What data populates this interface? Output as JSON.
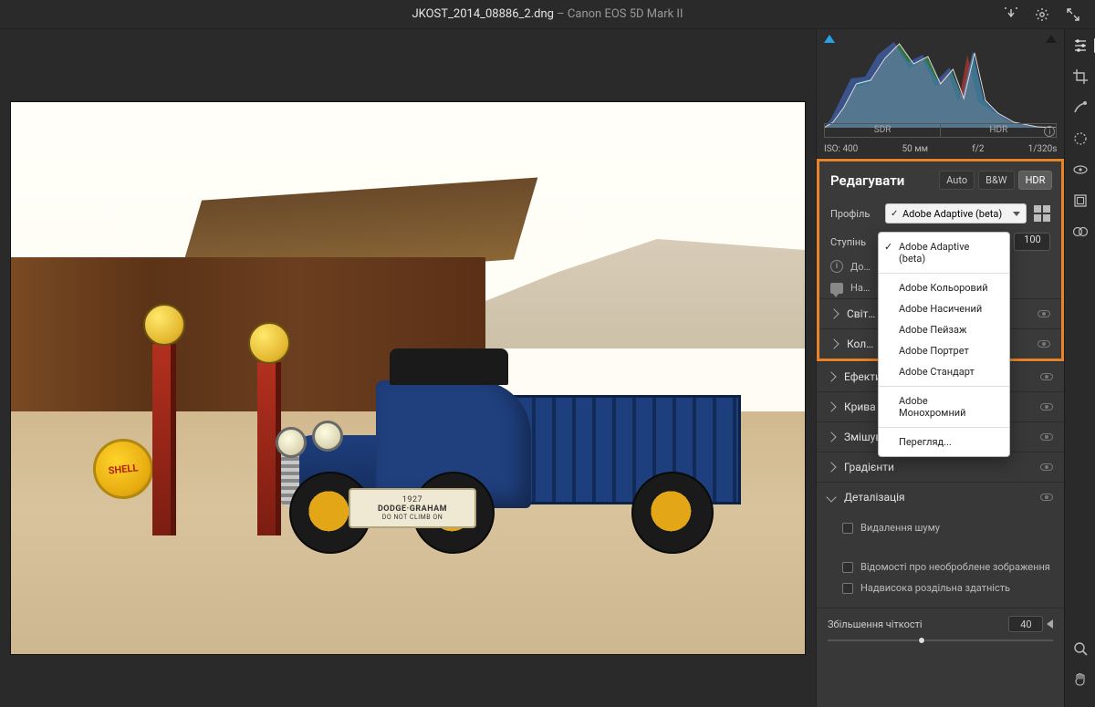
{
  "title": {
    "file": "JKOST_2014_08886_2.dng",
    "sep": "  –  ",
    "camera": "Canon EOS 5D Mark II"
  },
  "histogram": {
    "sdr_label": "SDR",
    "hdr_label": "HDR",
    "meta": {
      "iso": "ISO: 400",
      "focal": "50 мм",
      "aperture": "f/2",
      "shutter": "1/320s"
    }
  },
  "edit": {
    "header": "Редагувати",
    "auto": "Auto",
    "bw": "B&W",
    "hdr": "HDR",
    "profile_label": "Профіль",
    "profile_value": "Adobe Adaptive (beta)",
    "amount_label": "Ступінь",
    "amount_value": "100",
    "row1_label": "До…",
    "row2_label": "На…"
  },
  "profile_menu": {
    "items": [
      "Adobe Adaptive (beta)",
      "Adobe Кольоровий",
      "Adobe Насичений",
      "Adobe Пейзаж",
      "Adobe Портрет",
      "Adobe Стандарт"
    ],
    "mono": "Adobe Монохромний",
    "browse": "Перегляд..."
  },
  "accordions": {
    "light": "Світ…",
    "color": "Кол…",
    "effects": "Ефекти",
    "curve": "Крива",
    "mixer": "Змішувач кольорів",
    "gradients": "Градієнти",
    "detail": "Деталізація"
  },
  "detail": {
    "noise_cb": "Видалення шуму",
    "raw_cb": "Відомості про необроблене зображення",
    "super_cb": "Надвисока роздільна здатність",
    "clarity_label": "Збільшення чіткості",
    "clarity_value": "40"
  },
  "plate": {
    "year": "1927",
    "name": "DODGE·GRAHAM",
    "sub": "DO NOT CLIMB ON"
  }
}
